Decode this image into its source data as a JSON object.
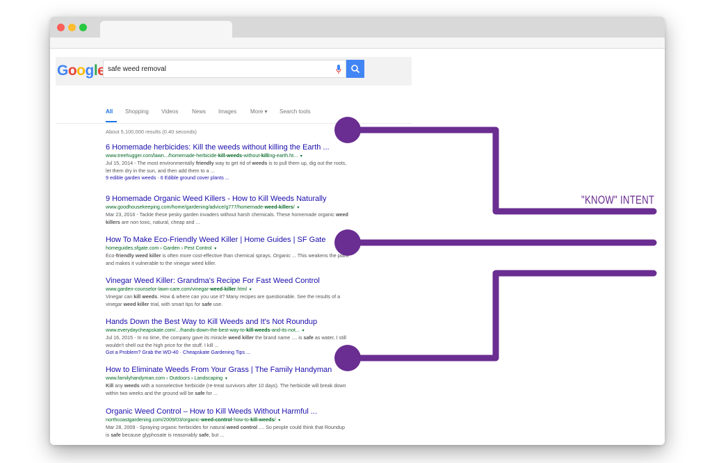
{
  "google": {
    "logo_letters": [
      {
        "ch": "G",
        "color": "#4285f4"
      },
      {
        "ch": "o",
        "color": "#ea4335"
      },
      {
        "ch": "o",
        "color": "#fbbc05"
      },
      {
        "ch": "g",
        "color": "#4285f4"
      },
      {
        "ch": "l",
        "color": "#34a853"
      },
      {
        "ch": "e",
        "color": "#ea4335"
      }
    ],
    "search_value": "safe weed removal",
    "icons": {
      "mic": "mic-icon",
      "search": "search-icon"
    }
  },
  "nav": {
    "tabs": [
      {
        "label": "All",
        "active": true
      },
      {
        "label": "Shopping",
        "active": false
      },
      {
        "label": "Videos",
        "active": false
      },
      {
        "label": "News",
        "active": false
      },
      {
        "label": "Images",
        "active": false
      },
      {
        "label": "More ▾",
        "active": false
      },
      {
        "label": "Search tools",
        "active": false
      }
    ]
  },
  "stats": "About 5,100,000 results (0.40 seconds)",
  "results": [
    {
      "title": "6 Homemade herbicides: Kill the weeds without killing the Earth ...",
      "url_html": "www.treehugger.com/lawn.../homemade-herbicide-<b>kill-weeds</b>-without-<b>kill</b>ing-earth.ht...",
      "snippet_html": "Jul 15, 2014 - The most environmentally <b>friendly</b> way to get rid of <b>weeds</b> is to pull them up, dig out the roots, let them dry in the sun, and then add them to a ...",
      "sitelinks": "9 edible garden weeds · 6 Edible ground cover plants ..."
    },
    {
      "title": "9 Homemade Organic Weed Killers - How to Kill Weeds Naturally",
      "url_html": "www.goodhousekeeping.com/home/gardening/advice/g777/homemade-<b>weed-killers</b>/",
      "snippet_html": "Mar 23, 2016 - Tackle these pesky garden invaders without harsh chemicals. These homemade organic <b>weed killers</b> are non toxic, natural, cheap and ...",
      "sitelinks": ""
    },
    {
      "title": "How To Make Eco-Friendly Weed Killer | Home Guides | SF Gate",
      "url_html": "homeguides.sfgate.com › Garden › Pest Control",
      "snippet_html": "Eco-<b>friendly weed killer</b> is often more cost-effective than chemical sprays. Organic ... This weakens the plant and makes it vulnerable to the vinegar weed killer.",
      "sitelinks": ""
    },
    {
      "title": "Vinegar Weed Killer: Grandma's Recipe For Fast Weed Control",
      "url_html": "www.garden-counselor-lawn-care.com/vinegar-<b>weed-killer</b>.html",
      "snippet_html": "Vinegar can <b>kill weeds</b>. How &amp; where can you use it? Many recipes are questionable. See the results of a vinegar <b>weed killer</b> trial, with smart tips for <b>safe</b> use.",
      "sitelinks": ""
    },
    {
      "title": "Hands Down the Best Way to Kill Weeds and It's Not Roundup",
      "url_html": "www.everydaycheapskate.com/.../hands-down-the-best-way-to-<b>kill-weeds</b>-and-its-not...",
      "snippet_html": "Jul 16, 2015 - In no time, the company gave its miracle <b>weed killer</b> the brand name .... is <b>safe</b> as water, I still wouldn't shell out the high price for the stuff. I kill ...",
      "sitelinks": "Got a Problem? Grab the WD-40 · Cheapskate Gardening Tips ..."
    },
    {
      "title": "How to Eliminate Weeds From Your Grass | The Family Handyman",
      "url_html": "www.familyhandyman.com › Outdoors › Landscaping",
      "snippet_html": "<b>Kill</b> any <b>weeds</b> with a nonselective herbicide (re-treat survivors after 10 days). The herbicide will break down within two weeks and the ground will be <b>safe</b> for ...",
      "sitelinks": ""
    },
    {
      "title": "Organic Weed Control – How to Kill Weeds Without Harmful ...",
      "url_html": "northcoastgardening.com/2009/03/organic-<b>weed-control</b>-how-to-<b>kill-weeds</b>/",
      "snippet_html": "Mar 28, 2009 - Spraying organic herbicides for natural <b>weed control</b> .... So people could think that Roundup is <b>safe</b> because glyphosate is reasonably <b>safe</b>, but ...",
      "sitelinks": ""
    }
  ],
  "annotation": {
    "label": "\"KNOW\" INTENT",
    "color": "#6a2d91"
  }
}
